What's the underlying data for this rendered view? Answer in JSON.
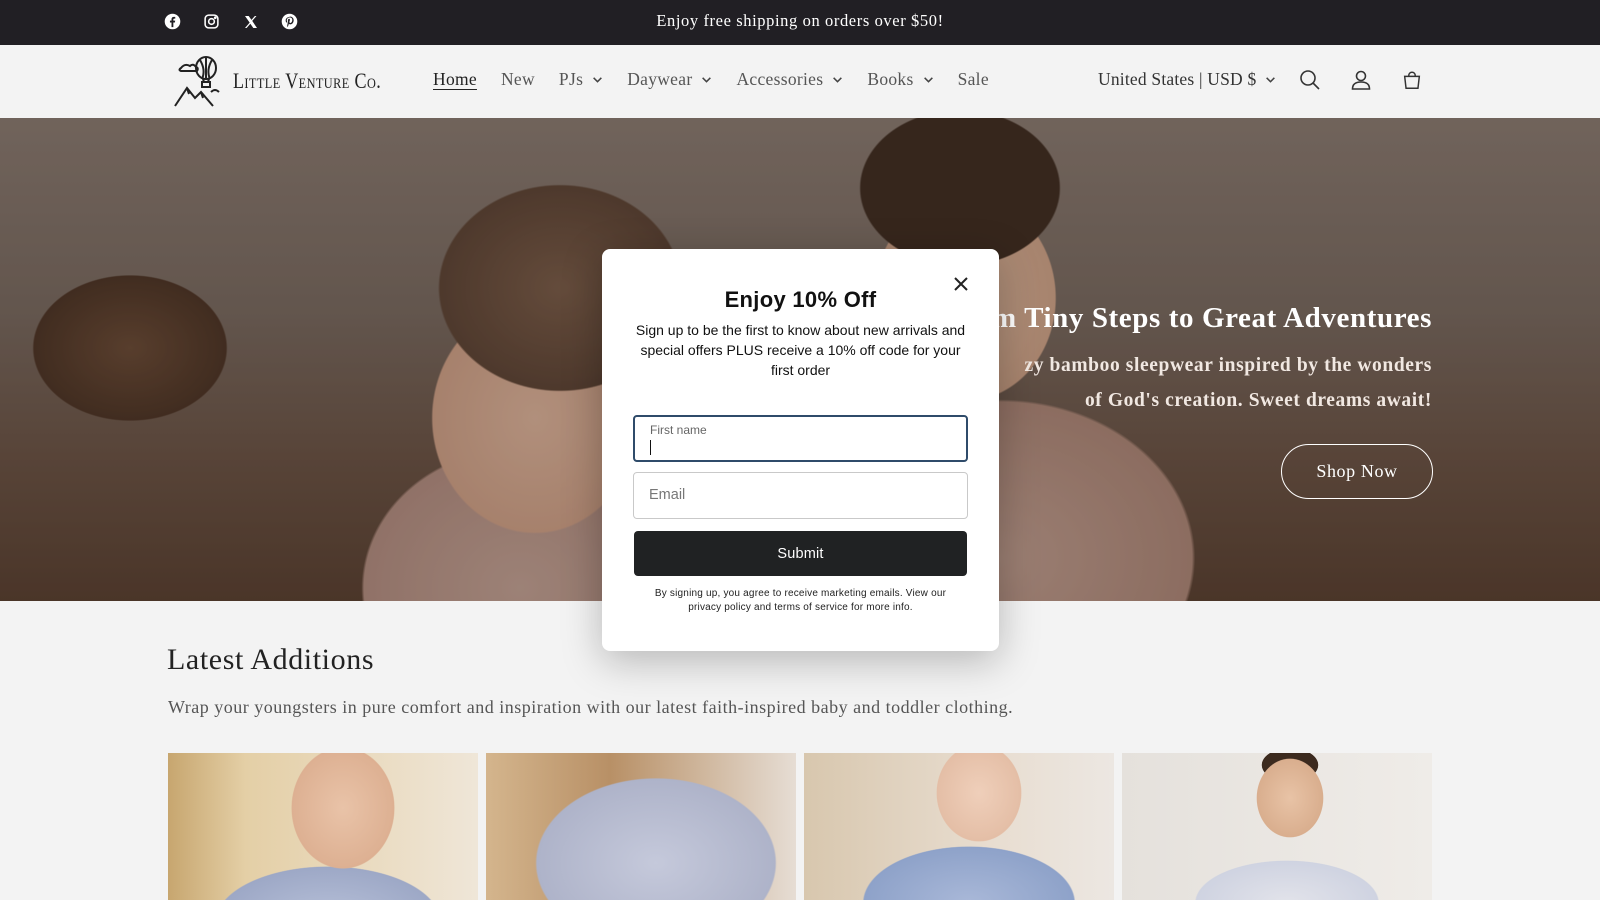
{
  "announcement": {
    "text": "Enjoy free shipping on orders over $50!",
    "socials": [
      "facebook-icon",
      "instagram-icon",
      "x-icon",
      "pinterest-icon"
    ]
  },
  "header": {
    "logo_text": "Little Venture Co.",
    "nav": [
      {
        "label": "Home",
        "active": true,
        "dropdown": false
      },
      {
        "label": "New",
        "active": false,
        "dropdown": false
      },
      {
        "label": "PJs",
        "active": false,
        "dropdown": true
      },
      {
        "label": "Daywear",
        "active": false,
        "dropdown": true
      },
      {
        "label": "Accessories",
        "active": false,
        "dropdown": true
      },
      {
        "label": "Books",
        "active": false,
        "dropdown": true
      },
      {
        "label": "Sale",
        "active": false,
        "dropdown": false
      }
    ],
    "locale": "United States | USD $",
    "icons": [
      "search-icon",
      "account-icon",
      "cart-icon"
    ]
  },
  "hero": {
    "title": "m Tiny Steps to Great Adventures",
    "subtitle_line1": "zy bamboo sleepwear inspired by the wonders",
    "subtitle_line2": "of God's creation. Sweet dreams await!",
    "cta": "Shop Now"
  },
  "latest": {
    "title": "Latest Additions",
    "description": "Wrap your youngsters in pure comfort and inspiration with our latest faith-inspired baby and toddler clothing."
  },
  "modal": {
    "title": "Enjoy 10% Off",
    "description": "Sign up to be the first to know about new arrivals and special offers PLUS receive a 10% off code for your first order",
    "first_name_label": "First name",
    "email_placeholder": "Email",
    "submit_label": "Submit",
    "legal": "By signing up, you agree to receive marketing emails. View our privacy policy and terms of service for more info."
  },
  "colors": {
    "announcement_bg": "#211f24",
    "page_bg": "#f3f3f3",
    "submit_bg": "#202223",
    "input_focus_border": "#2f4b6a"
  }
}
